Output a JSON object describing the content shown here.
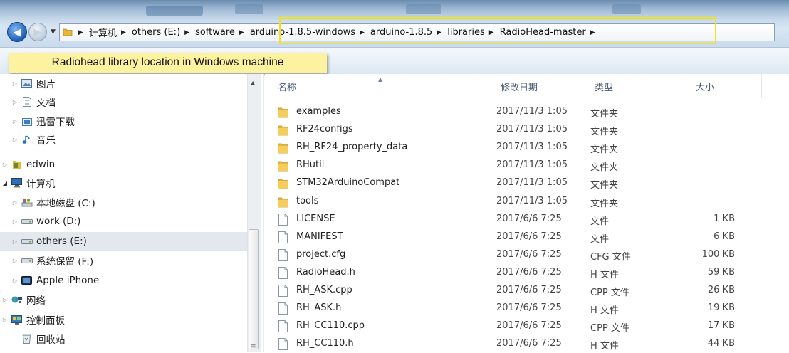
{
  "navigation": {
    "back_icon": "back-arrow-icon",
    "forward_icon": "forward-arrow-icon",
    "breadcrumbs": [
      {
        "label": "计算机"
      },
      {
        "label": "others (E:)"
      },
      {
        "label": "software"
      },
      {
        "label": "arduino-1.8.5-windows"
      },
      {
        "label": "arduino-1.8.5"
      },
      {
        "label": "libraries"
      },
      {
        "label": "RadioHead-master"
      }
    ]
  },
  "annotation": {
    "text": "Radiohead library location in Windows machine",
    "highlight_color": "#f2e21a"
  },
  "sidebar": {
    "items": [
      {
        "label": "图片",
        "icon": "pictures-icon",
        "selected": false
      },
      {
        "label": "文档",
        "icon": "documents-icon",
        "selected": false
      },
      {
        "label": "迅雷下载",
        "icon": "downloads-icon",
        "selected": false
      },
      {
        "label": "音乐",
        "icon": "music-icon",
        "selected": false
      },
      {
        "label": "edwin",
        "icon": "user-folder-icon",
        "selected": false
      },
      {
        "label": "计算机",
        "icon": "computer-icon",
        "selected": false
      },
      {
        "label": "本地磁盘 (C:)",
        "icon": "system-drive-icon",
        "selected": false
      },
      {
        "label": "work (D:)",
        "icon": "drive-icon",
        "selected": false
      },
      {
        "label": "others (E:)",
        "icon": "drive-icon",
        "selected": true
      },
      {
        "label": "系统保留 (F:)",
        "icon": "drive-icon",
        "selected": false
      },
      {
        "label": "Apple iPhone",
        "icon": "phone-icon",
        "selected": false
      },
      {
        "label": "网络",
        "icon": "network-icon",
        "selected": false
      },
      {
        "label": "控制面板",
        "icon": "control-panel-icon",
        "selected": false
      },
      {
        "label": "回收站",
        "icon": "recycle-bin-icon",
        "selected": false
      }
    ]
  },
  "columns": {
    "name": "名称",
    "date": "修改日期",
    "type": "类型",
    "size": "大小"
  },
  "files": [
    {
      "name": "examples",
      "date": "2017/11/3 1:05",
      "type": "文件夹",
      "size": "",
      "kind": "folder"
    },
    {
      "name": "RF24configs",
      "date": "2017/11/3 1:05",
      "type": "文件夹",
      "size": "",
      "kind": "folder"
    },
    {
      "name": "RH_RF24_property_data",
      "date": "2017/11/3 1:05",
      "type": "文件夹",
      "size": "",
      "kind": "folder"
    },
    {
      "name": "RHutil",
      "date": "2017/11/3 1:05",
      "type": "文件夹",
      "size": "",
      "kind": "folder"
    },
    {
      "name": "STM32ArduinoCompat",
      "date": "2017/11/3 1:05",
      "type": "文件夹",
      "size": "",
      "kind": "folder"
    },
    {
      "name": "tools",
      "date": "2017/11/3 1:05",
      "type": "文件夹",
      "size": "",
      "kind": "folder"
    },
    {
      "name": "LICENSE",
      "date": "2017/6/6 7:25",
      "type": "文件",
      "size": "1 KB",
      "kind": "file"
    },
    {
      "name": "MANIFEST",
      "date": "2017/6/6 7:25",
      "type": "文件",
      "size": "6 KB",
      "kind": "file"
    },
    {
      "name": "project.cfg",
      "date": "2017/6/6 7:25",
      "type": "CFG 文件",
      "size": "100 KB",
      "kind": "file"
    },
    {
      "name": "RadioHead.h",
      "date": "2017/6/6 7:25",
      "type": "H 文件",
      "size": "59 KB",
      "kind": "file"
    },
    {
      "name": "RH_ASK.cpp",
      "date": "2017/6/6 7:25",
      "type": "CPP 文件",
      "size": "26 KB",
      "kind": "file"
    },
    {
      "name": "RH_ASK.h",
      "date": "2017/6/6 7:25",
      "type": "H 文件",
      "size": "19 KB",
      "kind": "file"
    },
    {
      "name": "RH_CC110.cpp",
      "date": "2017/6/6 7:25",
      "type": "CPP 文件",
      "size": "17 KB",
      "kind": "file"
    },
    {
      "name": "RH_CC110.h",
      "date": "2017/6/6 7:25",
      "type": "H 文件",
      "size": "44 KB",
      "kind": "file"
    }
  ],
  "colors": {
    "folder": "#e8b73a",
    "selection": "#e3e8ee",
    "header_text": "#4a5b76"
  }
}
